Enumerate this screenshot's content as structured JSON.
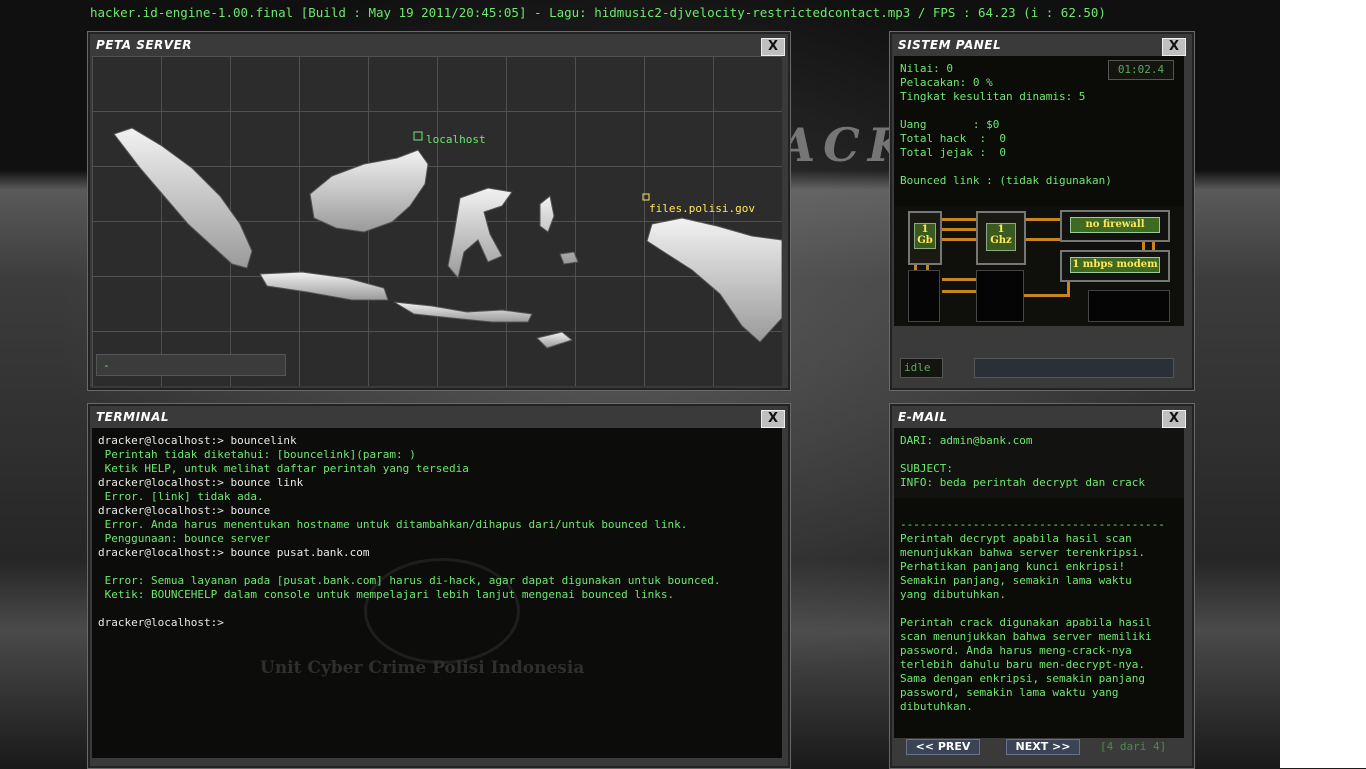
{
  "app": {
    "status_line": "hacker.id-engine-1.00.final [Build : May 19 2011/20:45:05] - Lagu: hidmusic2-djvelocity-restrictedcontact.mp3 / FPS : 64.23 (i : 62.50)",
    "background_text": "HACK",
    "close_glyph": "X"
  },
  "colors": {
    "terminal_green": "#6ee86e",
    "highlight_yellow": "#ffe85a",
    "close_bg": "#bfbfbf"
  },
  "peta_server": {
    "title": "PETA SERVER",
    "locations": [
      {
        "label": "localhost",
        "color": "#6ee86e"
      },
      {
        "label": "files.polisi.gov",
        "color": "#ffe85a"
      }
    ],
    "status_text": "-"
  },
  "sistem_panel": {
    "title": "SISTEM PANEL",
    "timer": "01:02.4",
    "lines": [
      "Nilai: 0",
      "Pelacakan: 0 %",
      "Tingkat kesulitan dinamis: 5",
      "",
      "Uang       : $0",
      "Total hack  :  0",
      "Total jejak :  0",
      "",
      "Bounced link : (tidak digunakan)"
    ],
    "ram": {
      "value": "1",
      "unit": "Gb"
    },
    "cpu": {
      "value": "1",
      "unit": "Ghz"
    },
    "firewall_label": "no firewall",
    "modem_label": "1 mbps modem",
    "status": "idle",
    "progress": 0
  },
  "terminal": {
    "title": "TERMINAL",
    "lines": [
      {
        "text": "dracker@localhost:> bouncelink",
        "type": "prompt"
      },
      {
        "text": " Perintah tidak diketahui: [bouncelink](param: )",
        "type": "output"
      },
      {
        "text": " Ketik HELP, untuk melihat daftar perintah yang tersedia",
        "type": "output"
      },
      {
        "text": "dracker@localhost:> bounce link",
        "type": "prompt"
      },
      {
        "text": " Error. [link] tidak ada.",
        "type": "output"
      },
      {
        "text": "dracker@localhost:> bounce",
        "type": "prompt"
      },
      {
        "text": " Error. Anda harus menentukan hostname untuk ditambahkan/dihapus dari/untuk bounced link.",
        "type": "output"
      },
      {
        "text": " Penggunaan: bounce server",
        "type": "output"
      },
      {
        "text": "dracker@localhost:> bounce pusat.bank.com",
        "type": "prompt"
      },
      {
        "text": "",
        "type": "output"
      },
      {
        "text": " Error: Semua layanan pada [pusat.bank.com] harus di-hack, agar dapat digunakan untuk bounced.",
        "type": "output"
      },
      {
        "text": " Ketik: BOUNCEHELP dalam console untuk mempelajari lebih lanjut mengenai bounced links.",
        "type": "output"
      },
      {
        "text": "",
        "type": "output"
      },
      {
        "text": "dracker@localhost:>",
        "type": "prompt"
      }
    ],
    "watermark": "Unit Cyber Crime Polisi Indonesia"
  },
  "email": {
    "title": "E-MAIL",
    "from": "DARI: admin@bank.com",
    "subject_label": "SUBJECT:",
    "subject": "INFO: beda perintah decrypt dan crack",
    "divider": "----------------------------------------",
    "body": [
      "Perintah decrypt apabila hasil scan",
      "menunjukkan bahwa server terenkripsi.",
      "Perhatikan panjang kunci enkripsi!",
      "Semakin panjang, semakin lama waktu",
      "yang dibutuhkan.",
      "",
      "Perintah crack digunakan apabila hasil",
      "scan menunjukkan bahwa server memiliki",
      "password. Anda harus meng-crack-nya",
      "terlebih dahulu baru men-decrypt-nya.",
      "Sama dengan enkripsi, semakin panjang",
      "password, semakin lama waktu yang",
      "dibutuhkan."
    ],
    "prev_label": "<< PREV",
    "next_label": "NEXT >>",
    "page": "[4 dari 4]"
  }
}
